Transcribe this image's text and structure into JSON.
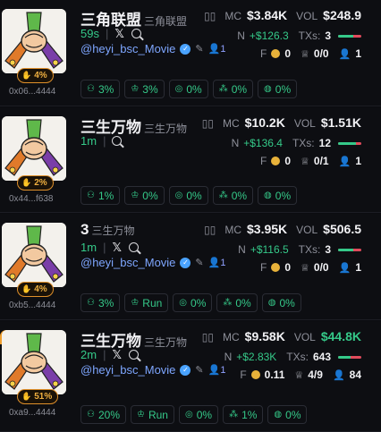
{
  "tokens": [
    {
      "name": "三角联盟",
      "symbol": "三角联盟",
      "age": "59s",
      "has_x": true,
      "handle": "@heyi_bsc_Movie",
      "holders_count": "1",
      "badge_pct": "4%",
      "address": "0x06...4444",
      "mc_label": "MC",
      "mc": "$3.84K",
      "vol_label": "VOL",
      "vol": "$248.9",
      "vol_green": false,
      "n_label": "N",
      "n_value": "+$126.3",
      "txs_label": "TXs:",
      "txs": "3",
      "buy_ratio": 0.67,
      "f_label": "F",
      "f_value": "0",
      "trophy": "0/0",
      "people": "1",
      "tags": [
        "3%",
        "3%",
        "0%",
        "0%",
        "0%"
      ],
      "highlighted": false
    },
    {
      "name": "三生万物",
      "symbol": "三生万物",
      "age": "1m",
      "has_x": false,
      "handle": "",
      "holders_count": "",
      "badge_pct": "2%",
      "address": "0x44...f638",
      "mc_label": "MC",
      "mc": "$10.2K",
      "vol_label": "VOL",
      "vol": "$1.51K",
      "vol_green": false,
      "n_label": "N",
      "n_value": "+$136.4",
      "txs_label": "TXs:",
      "txs": "12",
      "buy_ratio": 0.75,
      "f_label": "F",
      "f_value": "0",
      "trophy": "0/1",
      "people": "1",
      "tags": [
        "1%",
        "0%",
        "0%",
        "0%",
        "0%"
      ],
      "highlighted": false
    },
    {
      "name": "3",
      "symbol": "三生万物",
      "age": "1m",
      "has_x": true,
      "handle": "@heyi_bsc_Movie",
      "holders_count": "1",
      "badge_pct": "4%",
      "address": "0xb5...4444",
      "mc_label": "MC",
      "mc": "$3.95K",
      "vol_label": "VOL",
      "vol": "$506.5",
      "vol_green": false,
      "n_label": "N",
      "n_value": "+$116.5",
      "txs_label": "TXs:",
      "txs": "3",
      "buy_ratio": 0.67,
      "f_label": "F",
      "f_value": "0",
      "trophy": "0/0",
      "people": "1",
      "tags": [
        "3%",
        "Run",
        "0%",
        "0%",
        "0%"
      ],
      "highlighted": false
    },
    {
      "name": "三生万物",
      "symbol": "三生万物",
      "age": "2m",
      "has_x": true,
      "handle": "@heyi_bsc_Movie",
      "holders_count": "1",
      "badge_pct": "51%",
      "address": "0xa9...4444",
      "mc_label": "MC",
      "mc": "$9.58K",
      "vol_label": "VOL",
      "vol": "$44.8K",
      "vol_green": true,
      "n_label": "N",
      "n_value": "+$2.83K",
      "txs_label": "TXs:",
      "txs": "643",
      "buy_ratio": 0.55,
      "f_label": "F",
      "f_value": "0.11",
      "trophy": "4/9",
      "people": "84",
      "tags": [
        "20%",
        "Run",
        "0%",
        "1%",
        "0%"
      ],
      "highlighted": true
    }
  ],
  "tag_icons": [
    "people-icon",
    "chef-icon",
    "target-icon",
    "cluster-icon",
    "bundle-icon"
  ],
  "colors": {
    "accent_green": "#35c989",
    "sell_red": "#e04b5c",
    "badge_orange": "#e0902a",
    "link_blue": "#7ea6ff"
  }
}
